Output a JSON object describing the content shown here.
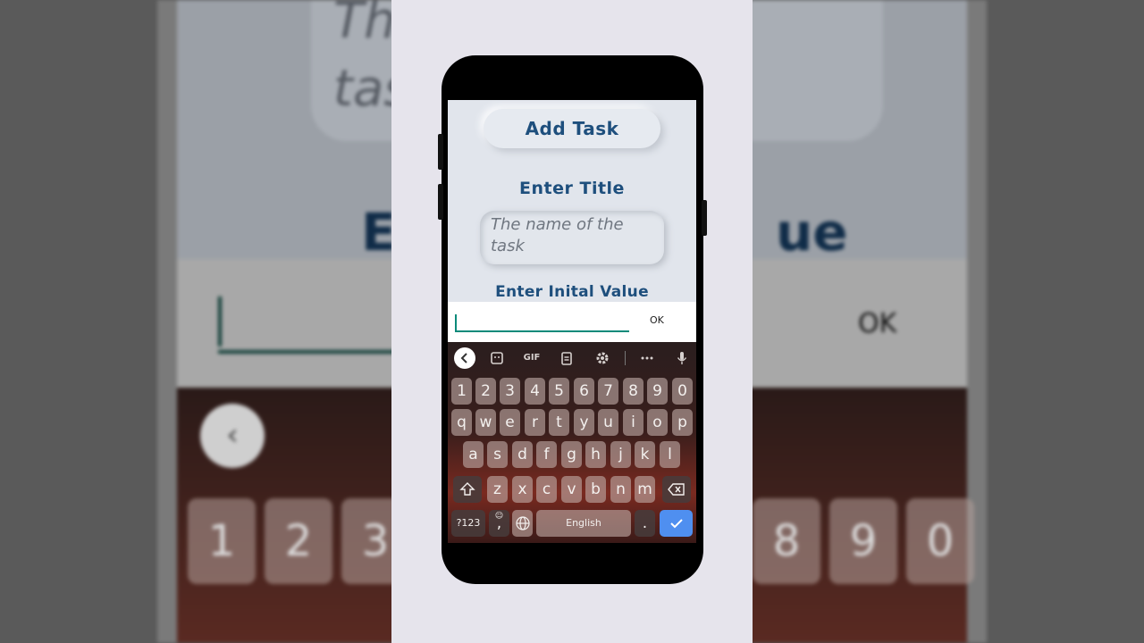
{
  "app": {
    "add_task_label": "Add Task",
    "title_heading": "Enter Title",
    "title_placeholder": "The name of the task",
    "value_heading": "Enter Inital Value"
  },
  "dialog": {
    "input_value": "",
    "ok_label": "OK"
  },
  "keyboard": {
    "toolbar": {
      "back_icon": "chevron-left-icon",
      "sticker_icon": "sticker-icon",
      "gif_label": "GIF",
      "clipboard_icon": "clipboard-icon",
      "settings_icon": "gear-icon",
      "more_icon": "more-icon",
      "mic_icon": "microphone-icon"
    },
    "row1": [
      "1",
      "2",
      "3",
      "4",
      "5",
      "6",
      "7",
      "8",
      "9",
      "0"
    ],
    "row2": [
      "q",
      "w",
      "e",
      "r",
      "t",
      "y",
      "u",
      "i",
      "o",
      "p"
    ],
    "row3": [
      "a",
      "s",
      "d",
      "f",
      "g",
      "h",
      "j",
      "k",
      "l"
    ],
    "row4": [
      "z",
      "x",
      "c",
      "v",
      "b",
      "n",
      "m"
    ],
    "symbols_label": "?123",
    "comma_label": ",",
    "space_label": "English",
    "period_label": "."
  },
  "background": {
    "title_text": "The name of the task",
    "heading_left": "En",
    "heading_right": "ue",
    "ok_label": "OK",
    "keys": [
      "1",
      "2",
      "3",
      "8",
      "9",
      "0"
    ]
  },
  "colors": {
    "accent": "#1e4f7d",
    "input_line": "#0a8a7a",
    "enter_key": "#4f8ff0"
  }
}
